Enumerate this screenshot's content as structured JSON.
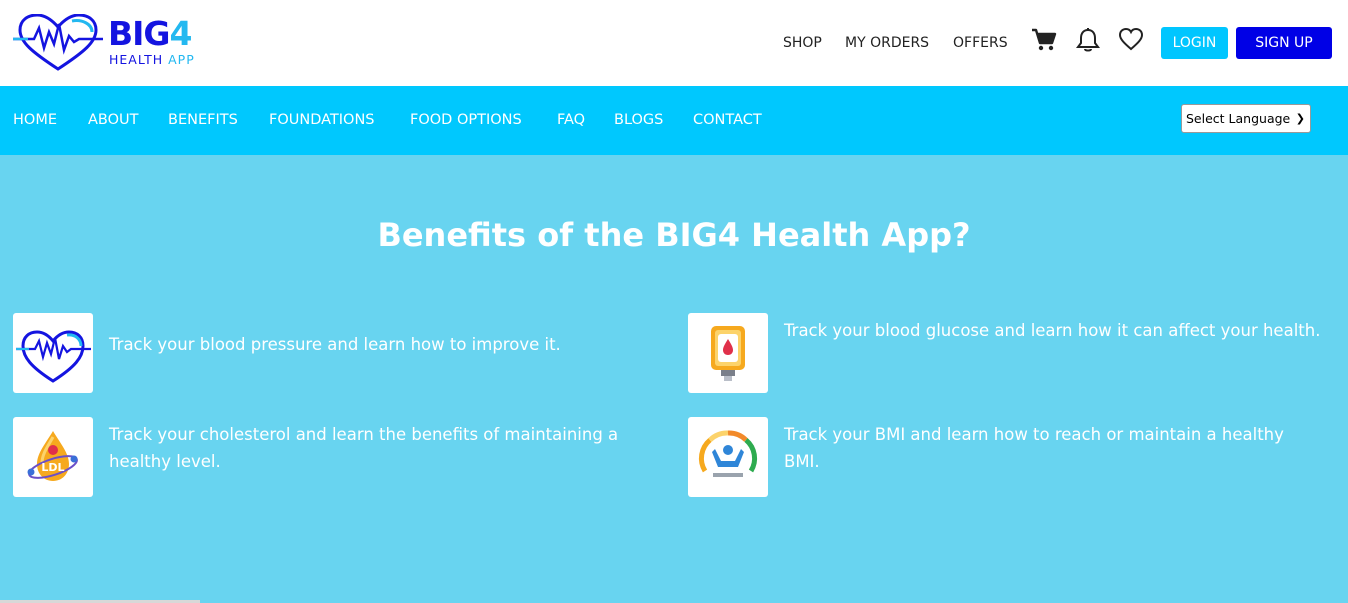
{
  "logo": {
    "word_big": "BIG",
    "word_four": "4",
    "sub_line1": "HEALTH",
    "sub_line2": "APP",
    "brand_blue": "#1414e0",
    "brand_cyan": "#23b8f0"
  },
  "top_nav": {
    "items": [
      "SHOP",
      "MY ORDERS",
      "OFFERS"
    ],
    "icons": [
      "cart-icon",
      "bell-icon",
      "heart-icon"
    ],
    "login_label": "LOGIN",
    "signup_label": "SIGN UP"
  },
  "main_nav": {
    "items": [
      "HOME",
      "ABOUT",
      "BENEFITS",
      "FOUNDATIONS",
      "FOOD OPTIONS",
      "FAQ",
      "BLOGS",
      "CONTACT"
    ],
    "language_select": "Select Language",
    "bg_color": "#00c8fe"
  },
  "hero": {
    "title": "Benefits of the BIG4 Health App?",
    "bg_color": "#68d4f0",
    "benefits": [
      {
        "icon": "heartbeat-icon",
        "text": "Track your blood pressure and learn how to improve it."
      },
      {
        "icon": "glucose-meter-icon",
        "text": "Track your blood glucose and learn how it can affect your health."
      },
      {
        "icon": "cholesterol-ldl-icon",
        "text": "Track your cholesterol and learn the benefits of maintaining a healthy level."
      },
      {
        "icon": "bmi-gauge-icon",
        "text": "Track your BMI and learn how to reach or maintain a healthy BMI."
      }
    ]
  }
}
